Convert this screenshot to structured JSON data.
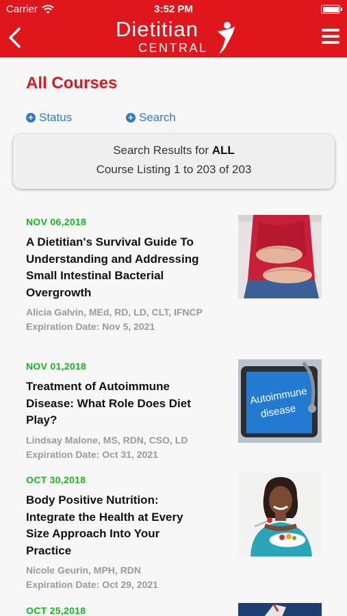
{
  "status_bar": {
    "carrier": "Carrier",
    "time": "3:52 PM"
  },
  "nav": {
    "logo_main": "Dietitian",
    "logo_sub": "CENTRAL"
  },
  "page": {
    "title": "All Courses"
  },
  "filters": {
    "status_label": "Status",
    "search_label": "Search"
  },
  "results": {
    "prefix": "Search Results for ",
    "query": "ALL",
    "listing": "Course Listing 1 to 203 of 203"
  },
  "courses": [
    {
      "date": "NOV 06,2018",
      "title": "A Dietitian's Survival Guide To Understanding and Addressing Small Intestinal Bacterial Overgrowth",
      "author": "Alicia Galvin, MEd, RD, LD, CLT, IFNCP",
      "expiration": "Expiration Date: Nov 5, 2021"
    },
    {
      "date": "NOV 01,2018",
      "title": "Treatment of Autoimmune Disease: What Role Does Diet Play?",
      "author": "Lindsay Malone, MS, RDN, CSO, LD",
      "expiration": "Expiration Date: Oct 31, 2021",
      "thumb_text": "Autoimmune disease"
    },
    {
      "date": "OCT 30,2018",
      "title": "Body Positive Nutrition: Integrate the Health at Every Size Approach Into Your Practice",
      "author": "Nicole Geurin, MPH, RDN",
      "expiration": "Expiration Date: Oct 29, 2021"
    },
    {
      "date": "OCT 25,2018"
    }
  ],
  "colors": {
    "brand_red": "#e0161d",
    "link_blue": "#2f79c2",
    "date_green": "#13b81c",
    "meta_gray": "#9a9a9a"
  }
}
